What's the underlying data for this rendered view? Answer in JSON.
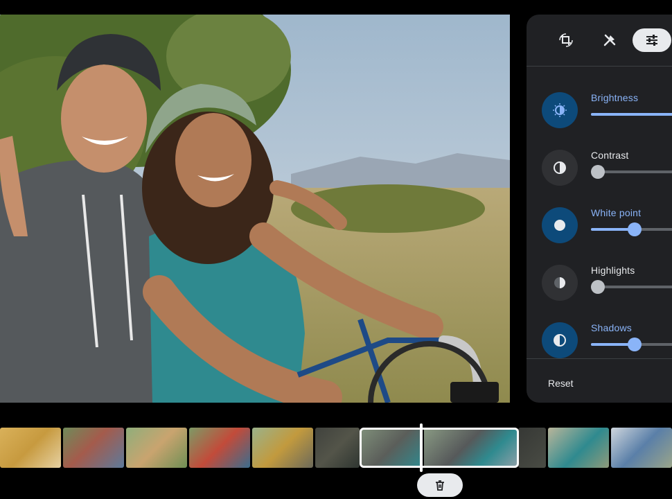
{
  "toolbar": {
    "tabs": [
      {
        "icon": "crop-rotate-icon",
        "active": false
      },
      {
        "icon": "tools-icon",
        "active": false
      },
      {
        "icon": "adjust-sliders-icon",
        "active": true
      }
    ]
  },
  "adjustments": [
    {
      "label": "Brightness",
      "active": true,
      "value": 1.0
    },
    {
      "label": "Contrast",
      "active": false,
      "value": 0.0
    },
    {
      "label": "White point",
      "active": true,
      "value": 0.45
    },
    {
      "label": "Highlights",
      "active": false,
      "value": 0.0
    },
    {
      "label": "Shadows",
      "active": true,
      "value": 0.45
    }
  ],
  "reset_label": "Reset",
  "timeline": {
    "thumbnail_count": 13,
    "selected_range": "clip"
  },
  "colors": {
    "accent": "#8ab4f8",
    "panel_bg": "#202124",
    "active_circle": "#0d4a7a"
  },
  "trash_icon": "trash-icon"
}
